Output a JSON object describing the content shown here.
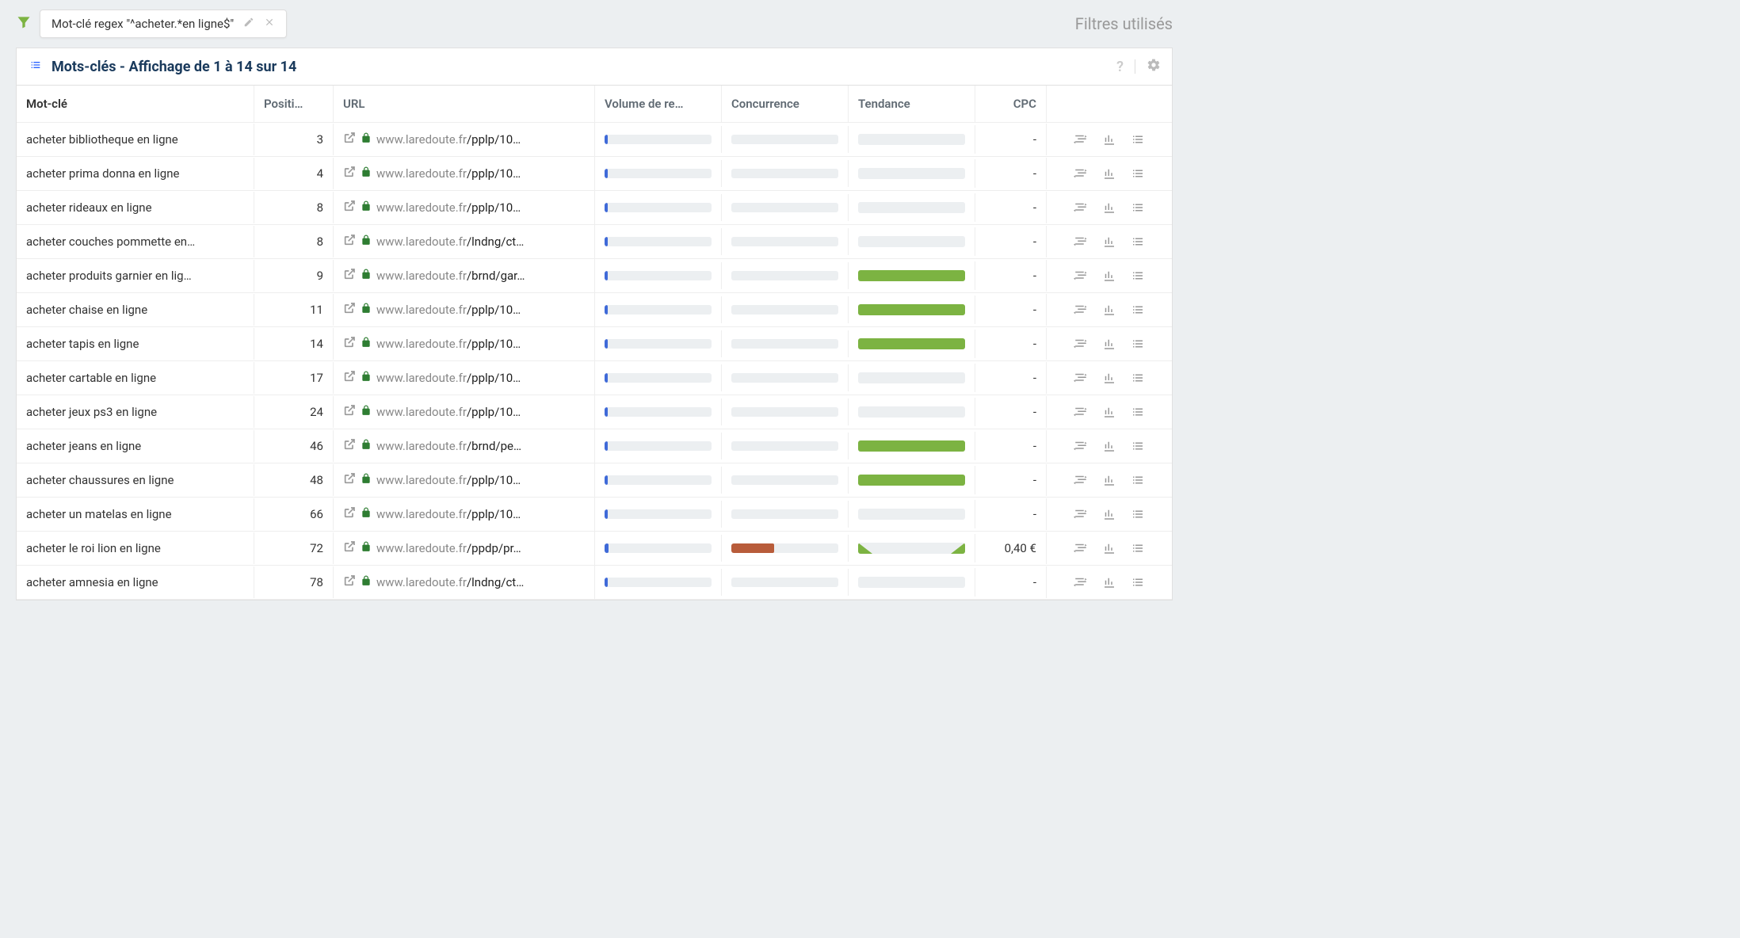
{
  "filter": {
    "chip_text": "Mot-clé regex \"^acheter.*en ligne$\"",
    "filters_used_label": "Filtres utilisés"
  },
  "panel": {
    "title": "Mots-clés - Affichage de 1 à 14 sur 14"
  },
  "columns": {
    "keyword": "Mot-clé",
    "position": "Positi…",
    "url": "URL",
    "volume": "Volume de re…",
    "concurrence": "Concurrence",
    "tendance": "Tendance",
    "cpc": "CPC"
  },
  "url_domain": "www.laredoute.fr",
  "rows": [
    {
      "keyword": "acheter bibliotheque en ligne",
      "position": "3",
      "url_path": "/pplp/10…",
      "volume_pct": 3,
      "concurrence_pct": 0,
      "trend": "empty",
      "cpc": "-"
    },
    {
      "keyword": "acheter prima donna en ligne",
      "position": "4",
      "url_path": "/pplp/10…",
      "volume_pct": 3,
      "concurrence_pct": 0,
      "trend": "empty",
      "cpc": "-"
    },
    {
      "keyword": "acheter rideaux en ligne",
      "position": "8",
      "url_path": "/pplp/10…",
      "volume_pct": 3,
      "concurrence_pct": 0,
      "trend": "empty",
      "cpc": "-"
    },
    {
      "keyword": "acheter couches pommette en…",
      "position": "8",
      "url_path": "/lndng/ct…",
      "volume_pct": 3,
      "concurrence_pct": 0,
      "trend": "empty",
      "cpc": "-"
    },
    {
      "keyword": "acheter produits garnier en lig…",
      "position": "9",
      "url_path": "/brnd/gar…",
      "volume_pct": 3,
      "concurrence_pct": 0,
      "trend": "full",
      "cpc": "-"
    },
    {
      "keyword": "acheter chaise en ligne",
      "position": "11",
      "url_path": "/pplp/10…",
      "volume_pct": 3,
      "concurrence_pct": 0,
      "trend": "full",
      "cpc": "-"
    },
    {
      "keyword": "acheter tapis en ligne",
      "position": "14",
      "url_path": "/pplp/10…",
      "volume_pct": 3,
      "concurrence_pct": 0,
      "trend": "full",
      "cpc": "-"
    },
    {
      "keyword": "acheter cartable en ligne",
      "position": "17",
      "url_path": "/pplp/10…",
      "volume_pct": 3,
      "concurrence_pct": 0,
      "trend": "empty",
      "cpc": "-"
    },
    {
      "keyword": "acheter jeux ps3 en ligne",
      "position": "24",
      "url_path": "/pplp/10…",
      "volume_pct": 3,
      "concurrence_pct": 0,
      "trend": "empty",
      "cpc": "-"
    },
    {
      "keyword": "acheter jeans en ligne",
      "position": "46",
      "url_path": "/brnd/pe…",
      "volume_pct": 3,
      "concurrence_pct": 0,
      "trend": "full",
      "cpc": "-"
    },
    {
      "keyword": "acheter chaussures en ligne",
      "position": "48",
      "url_path": "/pplp/10…",
      "volume_pct": 3,
      "concurrence_pct": 0,
      "trend": "full",
      "cpc": "-"
    },
    {
      "keyword": "acheter un matelas en ligne",
      "position": "66",
      "url_path": "/pplp/10…",
      "volume_pct": 3,
      "concurrence_pct": 0,
      "trend": "empty",
      "cpc": "-"
    },
    {
      "keyword": "acheter le roi lion en ligne",
      "position": "72",
      "url_path": "/ppdp/pr…",
      "volume_pct": 4,
      "concurrence_pct": 40,
      "concurrence_color": "orange",
      "trend": "rise",
      "cpc": "0,40 €"
    },
    {
      "keyword": "acheter amnesia en ligne",
      "position": "78",
      "url_path": "/lndng/ct…",
      "volume_pct": 3,
      "concurrence_pct": 0,
      "trend": "empty",
      "cpc": "-"
    }
  ]
}
